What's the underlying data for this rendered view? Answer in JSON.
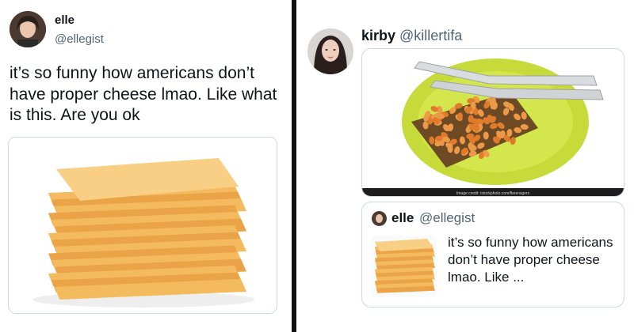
{
  "left_tweet": {
    "name": "elle",
    "handle": "@ellegist",
    "text": "it’s so funny how americans don’t have proper cheese lmao. Like what is this. Are you ok",
    "image_subject": "stack of american cheese slices"
  },
  "right_tweet": {
    "name": "kirby",
    "handle": "@killertifa",
    "image_subject": "beans on toast on a green plate with knife and fork",
    "image_credit": "Image credit: istockphoto.com/fkeensgers"
  },
  "quoted_tweet": {
    "name": "elle",
    "handle": "@ellegist",
    "text": "it’s so funny how americans don’t have proper cheese lmao. Like ..."
  },
  "colors": {
    "divider": "#111111",
    "plate": "#c6db3a",
    "beans": "#e07b2c",
    "cheese": "#f2b758"
  }
}
